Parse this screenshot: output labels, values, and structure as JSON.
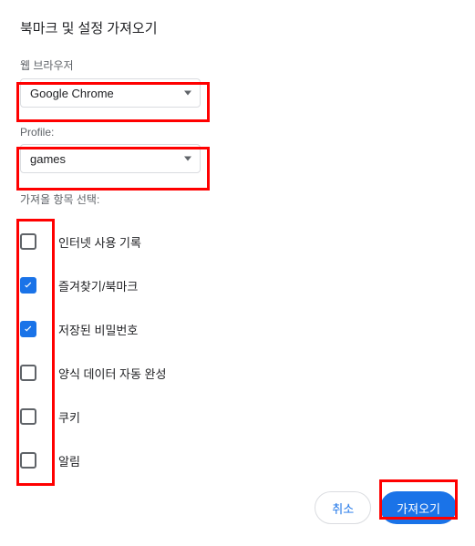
{
  "title": "북마크 및 설정 가져오기",
  "browser": {
    "label": "웹 브라우저",
    "value": "Google Chrome"
  },
  "profile": {
    "label": "Profile:",
    "value": "games"
  },
  "itemsLabel": "가져올 항목 선택:",
  "items": [
    {
      "label": "인터넷 사용 기록",
      "checked": false
    },
    {
      "label": "즐겨찾기/북마크",
      "checked": true
    },
    {
      "label": "저장된 비밀번호",
      "checked": true
    },
    {
      "label": "양식 데이터 자동 완성",
      "checked": false
    },
    {
      "label": "쿠키",
      "checked": false
    },
    {
      "label": "알림",
      "checked": false
    }
  ],
  "buttons": {
    "cancel": "취소",
    "import": "가져오기"
  }
}
